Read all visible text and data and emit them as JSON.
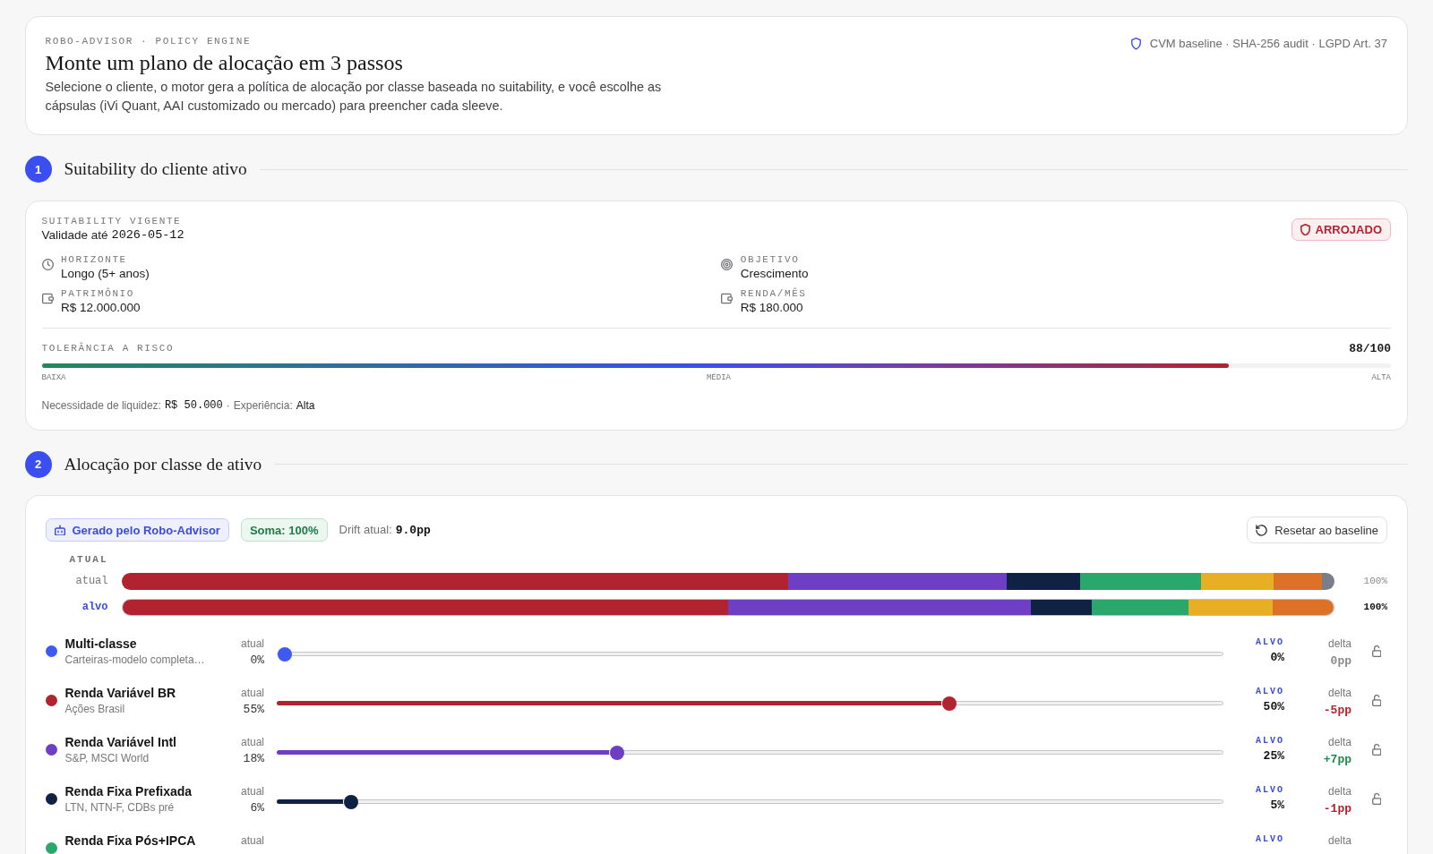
{
  "header": {
    "eyebrow": "ROBO-ADVISOR · POLICY ENGINE",
    "title": "Monte um plano de alocação em 3 passos",
    "description": "Selecione o cliente, o motor gera a política de alocação por classe baseada no suitability, e você escolhe as cápsulas (iVi Quant, AAI customizado ou mercado) para preencher cada sleeve.",
    "compliance_note": "CVM baseline · SHA-256 audit · LGPD Art. 37"
  },
  "suitability": {
    "step_number": "1",
    "step_title": "Suitability do cliente ativo",
    "eyebrow": "SUITABILITY VIGENTE",
    "validity": {
      "label": "Validade até",
      "date": "2026-05-12"
    },
    "profile": "ARROJADO",
    "fields": [
      {
        "kind": "horizon",
        "label": "HORIZONTE",
        "value": "Longo (5+ anos)"
      },
      {
        "kind": "objective",
        "label": "OBJETIVO",
        "value": "Crescimento"
      },
      {
        "kind": "wealth",
        "label": "PATRIMÔNIO",
        "value": "R$ 12.000.000"
      },
      {
        "kind": "income",
        "label": "RENDA/MÊS",
        "value": "R$ 180.000"
      }
    ],
    "risk": {
      "label": "TOLERÂNCIA A RISCO",
      "score": "88/100",
      "level": 0.88,
      "scale": [
        "BAIXA",
        "MÉDIA",
        "ALTA"
      ]
    },
    "facts": {
      "separator": "·",
      "items": [
        {
          "kind": "amount",
          "label": "Necessidade de liquidez:",
          "value": "R$ 50.000"
        },
        {
          "kind": "rating",
          "label": "Experiência:",
          "value": "Alta"
        }
      ]
    }
  },
  "allocation": {
    "step_number": "2",
    "step_title": "Alocação por classe de ativo",
    "source_badge": "Gerado pelo Robo-Advisor",
    "sum_badge": "Soma: 100%",
    "drift": {
      "label": "Drift atual:",
      "value": "9.0pp"
    },
    "reset_button": "Resetar ao baseline",
    "composition": {
      "heading": "ATUAL",
      "bars": [
        {
          "label": "atual",
          "total": "100%",
          "selected": false
        },
        {
          "label": "alvo",
          "total": "100%",
          "selected": true
        }
      ]
    },
    "classes": [
      {
        "name": "Multi-classe",
        "description": "Carteiras-modelo completa…",
        "color": "#3d5af1",
        "current_label": "atual",
        "current": "0%",
        "level": 0,
        "target_label": "ALVO",
        "target": "0%",
        "delta": {
          "label": "delta",
          "value": "0pp",
          "color": "#8a8a8f"
        },
        "locked": false
      },
      {
        "name": "Renda Variável BR",
        "description": "Ações Brasil",
        "color": "#b0232f",
        "current_label": "atual",
        "current": "55%",
        "level": 0.714,
        "target_label": "ALVO",
        "target": "50%",
        "delta": {
          "label": "delta",
          "value": "-5pp",
          "color": "#b0232f"
        },
        "locked": false
      },
      {
        "name": "Renda Variável Intl",
        "description": "S&P, MSCI World",
        "color": "#6e3fc4",
        "current_label": "atual",
        "current": "18%",
        "level": 0.357,
        "target_label": "ALVO",
        "target": "25%",
        "delta": {
          "label": "delta",
          "value": "+7pp",
          "color": "#1f8a4f"
        },
        "locked": false
      },
      {
        "name": "Renda Fixa Prefixada",
        "description": "LTN, NTN-F, CDBs pré",
        "color": "#0f2244",
        "current_label": "atual",
        "current": "6%",
        "level": 0.071,
        "target_label": "ALVO",
        "target": "5%",
        "delta": {
          "label": "delta",
          "value": "-1pp",
          "color": "#b0232f"
        },
        "locked": false
      },
      {
        "name": "Renda Fixa Pós+IPCA",
        "color": "#2aa86c",
        "current_label": "atual",
        "target_label": "ALVO",
        "delta": {
          "label": "delta"
        }
      }
    ]
  }
}
